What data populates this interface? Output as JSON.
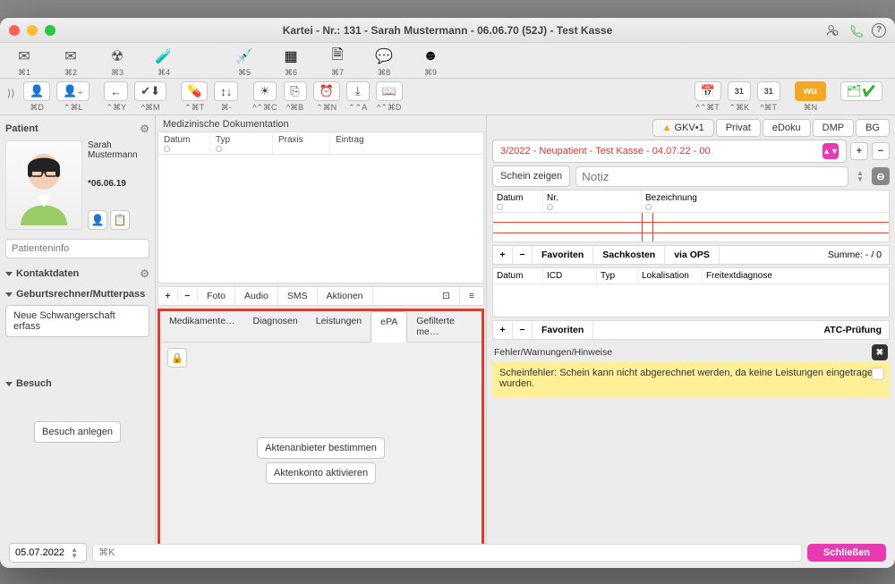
{
  "window": {
    "title": "Kartei - Nr.: 131 - Sarah Mustermann - 06.06.70 (52J) - Test Kasse"
  },
  "toolbar1": {
    "items": [
      {
        "short": "⌘1"
      },
      {
        "short": "⌘2"
      },
      {
        "short": "⌘3"
      },
      {
        "short": "⌘4"
      },
      {
        "short": "⌘5"
      },
      {
        "short": "⌘6"
      },
      {
        "short": "⌘7"
      },
      {
        "short": "⌘8"
      },
      {
        "short": "⌘9"
      }
    ]
  },
  "toolbar2": {
    "g1": [
      {
        "s": "⌘D"
      },
      {
        "s": "⌃⌘L"
      }
    ],
    "g2": [
      {
        "s": "⌃⌘Y"
      },
      {
        "s": "^⌘M"
      }
    ],
    "g3": [
      {
        "s": "⌃⌘T"
      },
      {
        "s": "⌘-"
      }
    ],
    "g4": [
      {
        "s": "^⌃⌘C"
      },
      {
        "s": "^⌘B"
      },
      {
        "s": "⌃⌘N"
      },
      {
        "s": "⌃⌃A"
      },
      {
        "s": "^⌃⌘D"
      }
    ],
    "g5": [
      {
        "s": "^⌃⌘T"
      },
      {
        "s": "⌃⌘K"
      },
      {
        "s": "^⌘T"
      }
    ],
    "g6": [
      {
        "s": "⌘N"
      }
    ],
    "wu": "wu"
  },
  "patient": {
    "section": "Patient",
    "firstname": "Sarah",
    "lastname": "Mustermann",
    "dob": "*06.06.19",
    "info_placeholder": "Patienteninfo",
    "kontakt": "Kontaktdaten",
    "geburt": "Geburtsrechner/Mutterpass",
    "schwanger_btn": "Neue Schwangerschaft erfass",
    "besuch": "Besuch",
    "besuch_btn": "Besuch anlegen"
  },
  "mid": {
    "header": "Medizinische Dokumentation",
    "cols": {
      "datum": "Datum",
      "typ": "Typ",
      "praxis": "Praxis",
      "eintrag": "Eintrag"
    },
    "actions": {
      "foto": "Foto",
      "audio": "Audio",
      "sms": "SMS",
      "aktionen": "Aktionen"
    },
    "tabs": {
      "med": "Medikamente…",
      "diag": "Diagnosen",
      "leist": "Leistungen",
      "epa": "ePA",
      "filt": "Gefilterte me…"
    },
    "epa": {
      "btn1": "Aktenanbieter bestimmen",
      "btn2": "Aktenkonto aktivieren"
    }
  },
  "right": {
    "tabs": {
      "gkv": "GKV•1",
      "privat": "Privat",
      "edoku": "eDoku",
      "dmp": "DMP",
      "bg": "BG"
    },
    "case": "3/2022 - Neupatient - Test Kasse - 04.07.22 - 00",
    "schein_btn": "Schein zeigen",
    "notiz_ph": "Notiz",
    "bill_cols": {
      "datum": "Datum",
      "nr": "Nr.",
      "bez": "Bezeichnung"
    },
    "fav": {
      "fav": "Favoriten",
      "sach": "Sachkosten",
      "ops": "via OPS",
      "sum": "Summe: - / 0"
    },
    "diag_cols": {
      "datum": "Datum",
      "icd": "ICD",
      "typ": "Typ",
      "lok": "Lokalisation",
      "frei": "Freitextdiagnose"
    },
    "fav2": {
      "fav": "Favoriten",
      "atc": "ATC-Prüfung"
    },
    "err_hdr": "Fehler/Warnungen/Hinweise",
    "err_msg": "Scheinfehler: Schein kann nicht abgerechnet werden, da keine Leistungen eingetragen wurden."
  },
  "footer": {
    "date": "05.07.2022",
    "cmdk": "⌘K",
    "close": "Schließen"
  }
}
